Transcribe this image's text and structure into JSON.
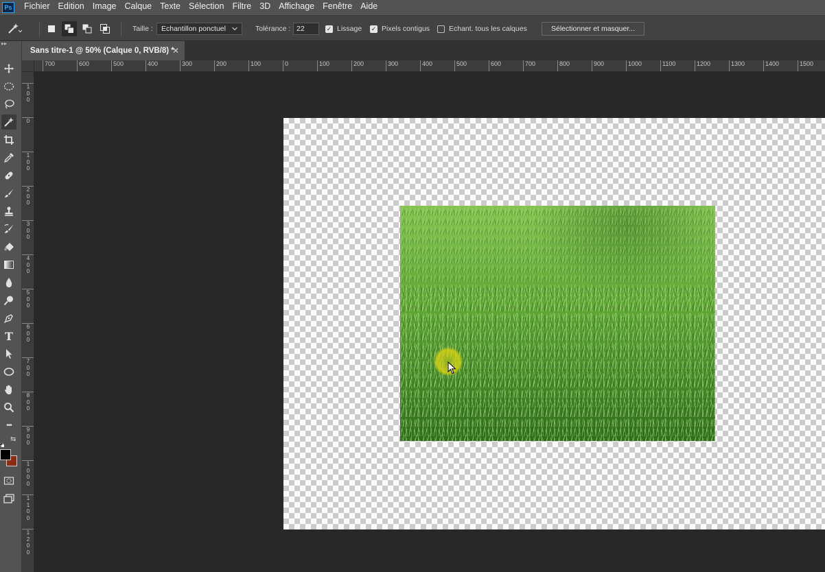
{
  "app": {
    "logo": "Ps"
  },
  "menu": [
    "Fichier",
    "Edition",
    "Image",
    "Calque",
    "Texte",
    "Sélection",
    "Filtre",
    "3D",
    "Affichage",
    "Fenêtre",
    "Aide"
  ],
  "options": {
    "tool_icon": "magic-wand-icon",
    "size_label": "Taille :",
    "size_value": "Echantillon ponctuel",
    "tolerance_label": "Tolérance :",
    "tolerance_value": "22",
    "antialias_label": "Lissage",
    "antialias_checked": true,
    "contiguous_label": "Pixels contigus",
    "contiguous_checked": true,
    "sample_all_label": "Echant. tous les calques",
    "sample_all_checked": false,
    "select_mask_label": "Sélectionner et masquer..."
  },
  "document": {
    "tab_title": "Sans titre-1 @ 50% (Calque 0, RVB/8) *",
    "close_glyph": "✕"
  },
  "ruler": {
    "horizontal": [
      "700",
      "600",
      "500",
      "400",
      "300",
      "200",
      "100",
      "0",
      "100",
      "200",
      "300",
      "400",
      "500",
      "600",
      "700",
      "800",
      "900",
      "1000",
      "1100",
      "1200",
      "1300",
      "1400",
      "1500"
    ],
    "vertical": [
      "100",
      "0",
      "100",
      "200",
      "300",
      "400",
      "500",
      "600",
      "700",
      "800",
      "900",
      "1000",
      "1100",
      "1200"
    ]
  },
  "toolbar": {
    "tools": [
      "move-icon",
      "ellipse-marquee-icon",
      "lasso-icon",
      "magic-wand-icon",
      "crop-icon",
      "eyedropper-icon",
      "healing-brush-icon",
      "brush-icon",
      "stamp-icon",
      "history-brush-icon",
      "eraser-icon",
      "gradient-icon",
      "blur-icon",
      "dodge-icon",
      "pen-icon",
      "type-icon",
      "path-select-icon",
      "ellipse-shape-icon",
      "hand-icon",
      "zoom-icon",
      "more-tools-icon"
    ],
    "text_tool_glyph": "T",
    "more_glyph": "•••",
    "swap_glyph": "⇆",
    "foreground_color": "#000000",
    "background_color": "#8b2c12"
  },
  "colors": {
    "grass_light": "#7cc04a",
    "grass_dark": "#2f6d1c",
    "checker_light": "#ffffff",
    "checker_dark": "#cccccc",
    "cursor_halo": "#d7d214"
  }
}
